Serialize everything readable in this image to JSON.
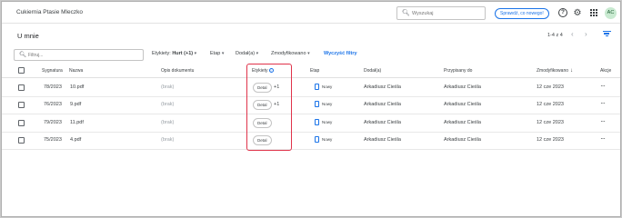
{
  "app": {
    "title": "Cukiernia Ptasie Mleczko",
    "search_placeholder": "Wyszukaj",
    "whats_new_label": "Sprawdź, co nowego!",
    "user_initials": "AC",
    "colors": {
      "accent": "#1a73e8",
      "highlight": "#e0334a",
      "avatar_bg": "#c9ead1"
    }
  },
  "page": {
    "title": "U mnie",
    "pagination": "1-4 z 4"
  },
  "filters": {
    "search_placeholder": "Filtruj...",
    "labels_prefix": "Etykiety:",
    "labels_value": "Hurt (+1)",
    "stage": "Etap",
    "added_by": "Dodał(a)",
    "modified": "Zmodyfikowano",
    "clear": "Wyczyść filtry"
  },
  "table": {
    "columns": {
      "signature": "Sygnatura",
      "name": "Nazwa",
      "description": "Opis dokumentu",
      "labels": "Etykiety",
      "stage": "Etap",
      "added_by": "Dodał(a)",
      "assigned_to": "Przypisany do",
      "modified": "Zmodyfikowano",
      "actions": "Akcje"
    },
    "rows": [
      {
        "signature": "78/2023",
        "name": "10.pdf",
        "description": "(brak)",
        "tag": "Detal",
        "more": "+1",
        "stage": "Nowy",
        "added_by": "Arkadiusz Cieśla",
        "assigned_to": "Arkadiusz Cieśla",
        "modified": "12 cze 2023"
      },
      {
        "signature": "76/2023",
        "name": "9.pdf",
        "description": "(brak)",
        "tag": "Detal",
        "more": "+1",
        "stage": "Nowy",
        "added_by": "Arkadiusz Cieśla",
        "assigned_to": "Arkadiusz Cieśla",
        "modified": "12 cze 2023"
      },
      {
        "signature": "79/2023",
        "name": "11.pdf",
        "description": "(brak)",
        "tag": "Detal",
        "more": "",
        "stage": "Nowy",
        "added_by": "Arkadiusz Cieśla",
        "assigned_to": "Arkadiusz Cieśla",
        "modified": "12 cze 2023"
      },
      {
        "signature": "75/2023",
        "name": "4.pdf",
        "description": "(brak)",
        "tag": "Detal",
        "more": "",
        "stage": "Nowy",
        "added_by": "Arkadiusz Cieśla",
        "assigned_to": "Arkadiusz Cieśla",
        "modified": "12 cze 2023"
      }
    ]
  },
  "icons": {
    "search": "search-icon",
    "help": "help-icon",
    "settings": "gear-icon",
    "apps": "apps-grid-icon",
    "filter": "filter-icon",
    "document": "document-icon",
    "more": "more-horizontal-icon",
    "info": "info-icon",
    "sort": "arrow-down-icon"
  }
}
